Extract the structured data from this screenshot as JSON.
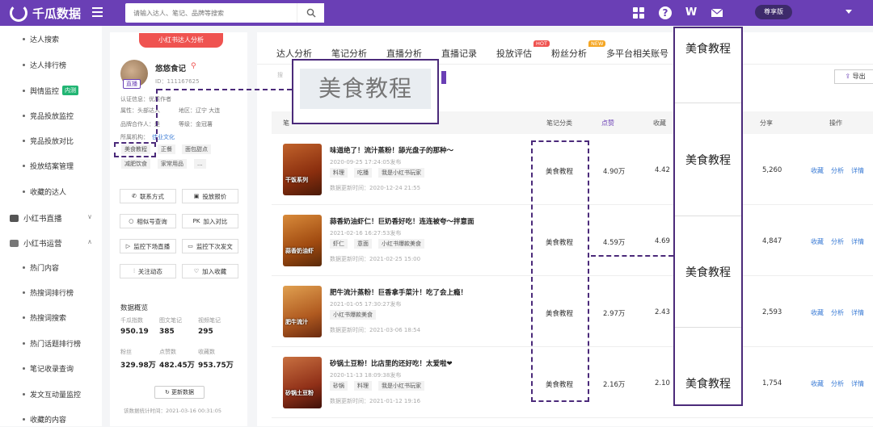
{
  "topbar": {
    "brand": "千瓜数据",
    "search_placeholder": "请输入达人、笔记、品牌等搜索",
    "vip_label": "尊享版"
  },
  "sidebar": {
    "items": [
      {
        "label": "达人搜索"
      },
      {
        "label": "达人排行榜"
      },
      {
        "label": "舆情监控",
        "badge": "内测"
      },
      {
        "label": "竞品投放监控"
      },
      {
        "label": "竞品投放对比"
      },
      {
        "label": "投放结案管理"
      },
      {
        "label": "收藏的达人"
      }
    ],
    "group_live": "小红书直播",
    "group_ops": "小红书运营",
    "ops_items": [
      {
        "label": "热门内容"
      },
      {
        "label": "热搜词排行榜"
      },
      {
        "label": "热搜词搜索"
      },
      {
        "label": "热门话题排行榜"
      },
      {
        "label": "笔记收录查询"
      },
      {
        "label": "发文互动量监控"
      },
      {
        "label": "收藏的内容"
      }
    ]
  },
  "profile": {
    "header_btn": "小红书达人分析",
    "name": "悠悠食记",
    "id": "ID：111167625",
    "live_tag": "直播",
    "cert": "认证信息：优质作者",
    "attr": "属性：头部达人",
    "region": "地区：辽宁 大连",
    "brand_partner": "品牌合作人：是",
    "level": "等级：金冠薯",
    "mcn_label": "所属机构：",
    "mcn_value": "佳业文化",
    "tags": [
      "美食教程",
      "正餐",
      "面包甜点",
      "减肥饮食",
      "家常用品",
      "..."
    ],
    "actions": [
      {
        "icon": "phone-icon",
        "label": "联系方式"
      },
      {
        "icon": "doc-icon",
        "label": "投放报价"
      },
      {
        "icon": "search-icon",
        "label": "相似号查询"
      },
      {
        "icon": "compare-icon",
        "label": "加入对比"
      },
      {
        "icon": "live-icon",
        "label": "监控下场直播"
      },
      {
        "icon": "monitor-icon",
        "label": "监控下次发文"
      },
      {
        "icon": "chart-icon",
        "label": "关注动态"
      },
      {
        "icon": "heart-icon",
        "label": "加入收藏"
      }
    ],
    "overview_title": "数据概览",
    "stats": [
      {
        "label": "千瓜指数",
        "value": "950.19"
      },
      {
        "label": "图文笔记",
        "value": "385"
      },
      {
        "label": "视频笔记",
        "value": "295"
      },
      {
        "label": "粉丝",
        "value": "329.98万"
      },
      {
        "label": "点赞数",
        "value": "482.45万"
      },
      {
        "label": "收藏数",
        "value": "953.75万"
      }
    ],
    "update_btn": "更新数据",
    "update_time": "该数据统计时间：2021-03-16 00:31:05"
  },
  "main": {
    "tabs": [
      {
        "label": "达人分析"
      },
      {
        "label": "笔记分析"
      },
      {
        "label": "直播分析"
      },
      {
        "label": "直播记录"
      },
      {
        "label": "投放评估",
        "badge": "HOT"
      },
      {
        "label": "粉丝分析",
        "badge": "NEW"
      },
      {
        "label": "多平台相关账号"
      }
    ],
    "search_hint": "搜",
    "export_label": "导出",
    "columns": [
      "笔",
      "笔记分类",
      "点赞",
      "收藏",
      "分享",
      "操作"
    ],
    "rows": [
      {
        "thumb_text": "干饭系列",
        "title": "味道绝了！流汁蒸粉！舔光盘子的那种～",
        "date": "2020-09-25 17:24:05发布",
        "tags": [
          "料理",
          "吃播",
          "我是小红书玩家"
        ],
        "updated": "数据更新时间：2020-12-24 21:55",
        "category": "美食教程",
        "likes": "4.90万",
        "collects": "4.42",
        "shares": "5,260"
      },
      {
        "thumb_text": "蒜香奶油虾",
        "title": "蒜香奶油虾仁！巨奶香好吃！连连被夸～拌意面",
        "date": "2021-02-16 16:27:53发布",
        "tags": [
          "虾仁",
          "意面",
          "小红书爆款美食"
        ],
        "updated": "数据更新时间：2021-02-25 15:00",
        "category": "美食教程",
        "likes": "4.59万",
        "collects": "4.69",
        "shares": "4,847"
      },
      {
        "thumb_text": "肥牛流汁",
        "title": "肥牛流汁蒸粉！巨香拿手菜汁！吃了会上瘾！",
        "date": "2021-01-05 17:30:27发布",
        "tags": [
          "小红书爆款美食"
        ],
        "updated": "数据更新时间：2021-03-06 18:54",
        "category": "美食教程",
        "likes": "2.97万",
        "collects": "2.43",
        "shares": "2,593"
      },
      {
        "thumb_text": "砂锅土豆粉",
        "title": "砂锅土豆粉！比店里的还好吃！太爱啦❤",
        "date": "2020-11-13 18:09:38发布",
        "tags": [
          "砂锅",
          "料理",
          "我是小红书玩家"
        ],
        "updated": "数据更新时间：2021-01-12 19:16",
        "category": "美食教程",
        "likes": "2.16万",
        "collects": "2.10",
        "shares": "1,754"
      }
    ],
    "ops": [
      "收藏",
      "分析",
      "详情"
    ]
  },
  "annotation": {
    "zoom_text": "美食教程",
    "overlay_cells": [
      "美食教程",
      "美食教程",
      "美食教程",
      "美食教程"
    ]
  },
  "colors": {
    "brand": "#6a3fb5",
    "annotation": "#4b2a7a",
    "link": "#3a7bd5"
  }
}
